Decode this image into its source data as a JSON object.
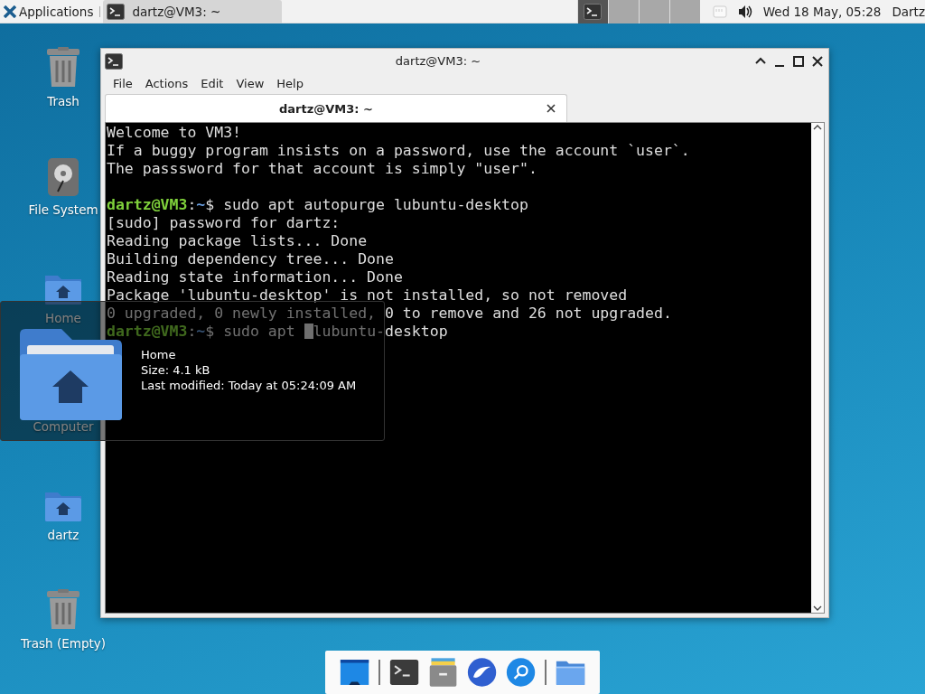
{
  "top_panel": {
    "app_menu": "Applications",
    "tasks": [
      {
        "title": "dartz@VM3: ~",
        "selected": true
      }
    ],
    "workspaces": [
      {
        "selected": true
      },
      {
        "selected": false
      },
      {
        "selected": false
      },
      {
        "selected": false
      }
    ],
    "clock": "Wed 18 May, 05:28",
    "user": "Dartz"
  },
  "desktop_icons": [
    {
      "label": "Trash",
      "kind": "trash"
    },
    {
      "label": "File System",
      "kind": "drive"
    },
    {
      "label": "Home",
      "kind": "home-folder"
    },
    {
      "label": "Computer",
      "kind": "computer"
    },
    {
      "label": "dartz",
      "kind": "home-folder"
    },
    {
      "label": "Trash (Empty)",
      "kind": "trash"
    }
  ],
  "window": {
    "title": "dartz@VM3: ~",
    "menu": [
      "File",
      "Actions",
      "Edit",
      "View",
      "Help"
    ],
    "tabs": [
      {
        "label": "dartz@VM3: ~",
        "selected": true
      }
    ],
    "lines": [
      {
        "kind": "output",
        "text": "Welcome to VM3!"
      },
      {
        "kind": "output",
        "text": "If a buggy program insists on a password, use the account `user`."
      },
      {
        "kind": "output",
        "text": "The passsword for that account is simply \"user\"."
      },
      {
        "kind": "blank"
      },
      {
        "kind": "prompt",
        "user": "dartz@VM3",
        "colon": ":",
        "path": "~",
        "sign": "$",
        "command": "sudo apt autopurge lubuntu-desktop"
      },
      {
        "kind": "output",
        "text": "[sudo] password for dartz:"
      },
      {
        "kind": "output",
        "text": "Reading package lists... Done"
      },
      {
        "kind": "output",
        "text": "Building dependency tree... Done"
      },
      {
        "kind": "output",
        "text": "Reading state information... Done"
      },
      {
        "kind": "output",
        "text": "Package 'lubuntu-desktop' is not installed, so not removed"
      },
      {
        "kind": "output",
        "text": "0 upgraded, 0 newly installed, 0 to remove and 26 not upgraded."
      },
      {
        "kind": "prompt",
        "user": "dartz@VM3",
        "colon": ":",
        "path": "~",
        "sign": "$",
        "command": "sudo apt ",
        "cursor": true,
        "command_rest": "lubuntu-desktop"
      }
    ]
  },
  "tooltip": {
    "name": "Home",
    "details": [
      "Size: 4.1 kB",
      "Last modified: Today at 05:24:09 AM"
    ]
  },
  "dock": [
    {
      "kind": "desktop"
    },
    {
      "kind": "separator"
    },
    {
      "kind": "terminal"
    },
    {
      "kind": "file-cabinet"
    },
    {
      "kind": "browser"
    },
    {
      "kind": "search"
    },
    {
      "kind": "separator"
    },
    {
      "kind": "folder"
    }
  ]
}
